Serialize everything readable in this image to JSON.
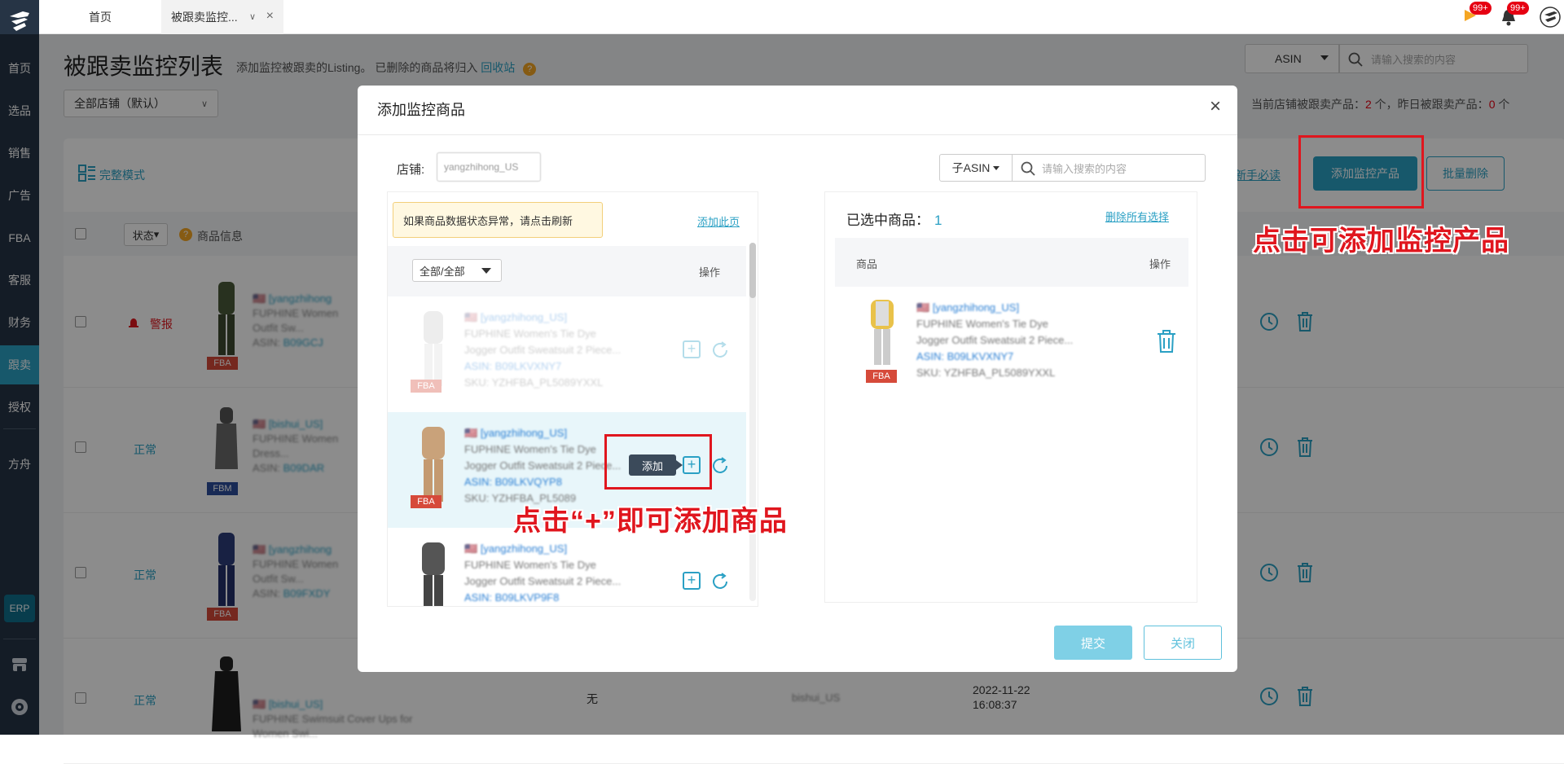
{
  "sidebar": {
    "items": [
      {
        "label": "首页",
        "active": false
      },
      {
        "label": "选品",
        "active": false
      },
      {
        "label": "销售",
        "active": false
      },
      {
        "label": "广告",
        "active": false
      },
      {
        "label": "FBA",
        "active": false
      },
      {
        "label": "客服",
        "active": false
      },
      {
        "label": "财务",
        "active": false
      },
      {
        "label": "跟卖",
        "active": true
      },
      {
        "label": "授权",
        "active": false
      },
      {
        "label": "方舟",
        "active": false
      }
    ],
    "erp_label": "ERP",
    "accent_color": "#2aa0c4"
  },
  "tabs": {
    "home": "首页",
    "active": "被跟卖监控..."
  },
  "header_badges": {
    "flag_count": "99+",
    "bell_count": "99+"
  },
  "page": {
    "title": "被跟卖监控列表",
    "subtitle": "添加监控被跟卖的Listing。 已删除的商品将归入",
    "recycle_link": "回收站",
    "store_select": "全部店铺（默认）",
    "search_type": "ASIN",
    "search_placeholder": "请输入搜索的内容",
    "stats_prefix": "当前店铺被跟卖产品：",
    "stats_current": "2",
    "stats_mid": " 个，昨日被跟卖产品：",
    "stats_yesterday": "0",
    "stats_suffix": " 个",
    "mode_link": "完整模式",
    "newbie_link": "新手必读",
    "add_monitor_button": "添加监控产品",
    "batch_delete_button": "批量删除",
    "col_status": "状态",
    "col_product_info": "商品信息",
    "rows": [
      {
        "status": "警报",
        "tag": "FBA"
      },
      {
        "status": "正常",
        "tag": "FBM"
      },
      {
        "status": "正常",
        "tag": "FBA"
      },
      {
        "status": "正常",
        "tag": "",
        "col_seller": "无",
        "col_store": "bishui_US",
        "date": "2022-11-22",
        "time": "16:08:37"
      }
    ]
  },
  "modal": {
    "title": "添加监控商品",
    "store_label": "店铺:",
    "store_value": "yangzhihong_US",
    "search_type": "子ASIN",
    "search_placeholder": "请输入搜索的内容",
    "notice": "如果商品数据状态异常，请点击刷新",
    "add_page_link": "添加此页",
    "filter_select": "全部/全部",
    "op_header": "操作",
    "products": [
      {
        "store": "[yangzhihong_US]",
        "line1": "FUPHINE Women's Tie Dye",
        "line2": "Jogger Outfit Sweatsuit 2 Piece...",
        "asin": "ASIN: B09LKVXNY7",
        "sku": "SKU: YZHFBA_PL5089YXXL",
        "tag": "FBA"
      },
      {
        "store": "[yangzhihong_US]",
        "line1": "FUPHINE Women's Tie Dye",
        "line2": "Jogger Outfit Sweatsuit 2 Piece...",
        "asin": "ASIN: B09LKVQYP8",
        "sku": "SKU: YZHFBA_PL5089",
        "tag": "FBA"
      },
      {
        "store": "[yangzhihong_US]",
        "line1": "FUPHINE Women's Tie Dye",
        "line2": "Jogger Outfit Sweatsuit 2 Piece...",
        "asin": "ASIN: B09LKVP9F8",
        "sku": "",
        "tag": ""
      }
    ],
    "tooltip_add": "添加",
    "selected_label": "已选中商品：",
    "selected_count": "1",
    "delete_all_link": "删除所有选择",
    "col_product": "商品",
    "col_op": "操作",
    "selected_item": {
      "store": "[yangzhihong_US]",
      "line1": "FUPHINE Women's Tie Dye",
      "line2": "Jogger Outfit Sweatsuit 2 Piece...",
      "asin": "ASIN: B09LKVXNY7",
      "sku": "SKU: YZHFBA_PL5089YXXL",
      "tag": "FBA"
    },
    "submit_button": "提交",
    "close_button": "关闭"
  },
  "annotations": {
    "add_monitor_hint": "点击可添加监控产品",
    "add_item_hint": "点击“+”即可添加商品",
    "color": "#e0161e"
  }
}
